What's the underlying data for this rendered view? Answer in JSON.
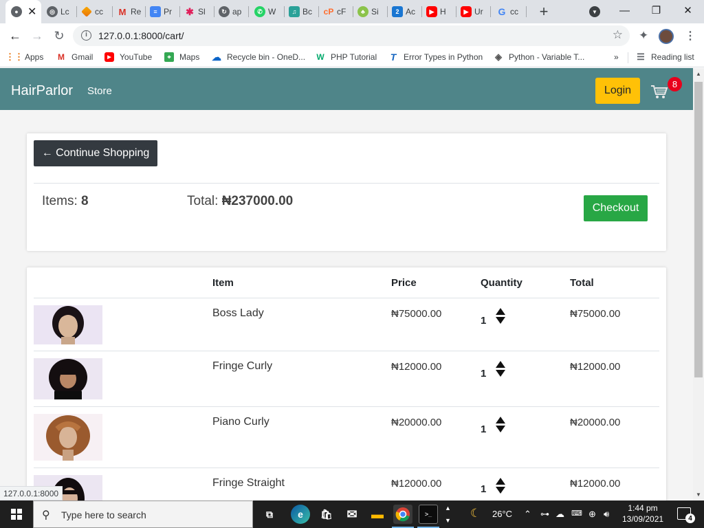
{
  "browser": {
    "tabs": [
      {
        "label": "",
        "active": true,
        "icon": "chrome-globe-icon"
      },
      {
        "label": "Lc",
        "icon": "globe-icon"
      },
      {
        "label": "cc",
        "icon": "colab-icon"
      },
      {
        "label": "Re",
        "icon": "gmail-icon"
      },
      {
        "label": "Pr",
        "icon": "docs-icon"
      },
      {
        "label": "Sl",
        "icon": "slack-icon"
      },
      {
        "label": "ap",
        "icon": "sync-icon"
      },
      {
        "label": "W",
        "icon": "whatsapp-icon"
      },
      {
        "label": "Bc",
        "icon": "music-icon"
      },
      {
        "label": "cF",
        "icon": "cpanel-icon"
      },
      {
        "label": "Si",
        "icon": "tree-icon"
      },
      {
        "label": "Ac",
        "icon": "two-icon"
      },
      {
        "label": "H",
        "icon": "youtube-icon"
      },
      {
        "label": "Ur",
        "icon": "youtube-icon"
      },
      {
        "label": "cc",
        "icon": "google-icon"
      }
    ],
    "url": "127.0.0.1:8000/cart/",
    "bookmarks": [
      {
        "label": "Apps",
        "icon": "apps-grid-icon"
      },
      {
        "label": "Gmail",
        "icon": "gmail-icon"
      },
      {
        "label": "YouTube",
        "icon": "youtube-icon"
      },
      {
        "label": "Maps",
        "icon": "maps-icon"
      },
      {
        "label": "Recycle bin - OneD...",
        "icon": "onedrive-icon"
      },
      {
        "label": "PHP Tutorial",
        "icon": "w3schools-icon"
      },
      {
        "label": "Error Types in Python",
        "icon": "tutorial-icon"
      },
      {
        "label": "Python - Variable T...",
        "icon": "diamond-icon"
      }
    ],
    "more_bookmarks": "»",
    "reading_list": "Reading list",
    "status_url": "127.0.0.1:8000"
  },
  "site": {
    "brand": "HairParlor",
    "store_link": "Store",
    "login": "Login",
    "cart_count": "8",
    "continue_shopping": "← Continue Shopping",
    "items_label": "Items:",
    "items_value": "8",
    "total_label": "Total:",
    "total_value": "₦237000.00",
    "checkout": "Checkout",
    "headers": {
      "item": "Item",
      "price": "Price",
      "quantity": "Quantity",
      "total": "Total"
    },
    "rows": [
      {
        "name": "Boss Lady",
        "price": "₦75000.00",
        "qty": "1",
        "total": "₦75000.00"
      },
      {
        "name": "Fringe Curly",
        "price": "₦12000.00",
        "qty": "1",
        "total": "₦12000.00"
      },
      {
        "name": "Piano Curly",
        "price": "₦20000.00",
        "qty": "1",
        "total": "₦20000.00"
      },
      {
        "name": "Fringe Straight",
        "price": "₦12000.00",
        "qty": "1",
        "total": "₦12000.00"
      }
    ]
  },
  "taskbar": {
    "search_placeholder": "Type here to search",
    "weather": "26°C",
    "time": "1:44 pm",
    "date": "13/09/2021",
    "notifications": "4"
  },
  "colors": {
    "navbar": "#4f8589",
    "login_button": "#ffc107",
    "checkout_button": "#28a745",
    "continue_button": "#343a40",
    "cart_badge": "#e8001c"
  }
}
